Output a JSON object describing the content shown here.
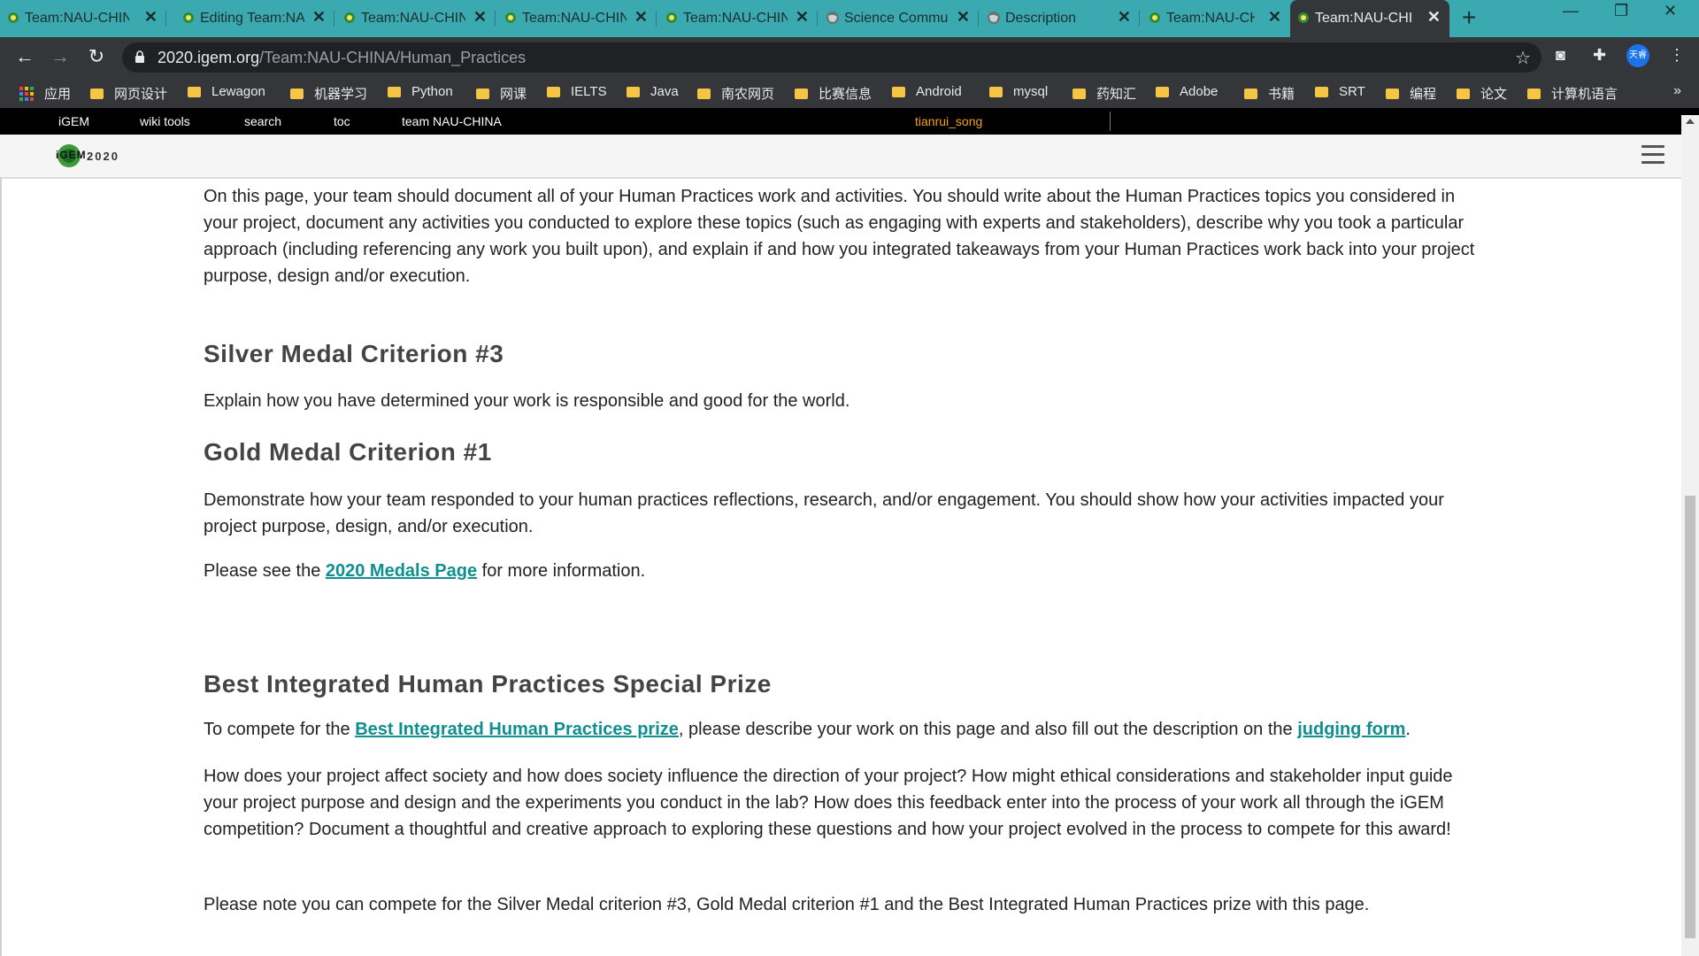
{
  "tabs": [
    {
      "title": "Team:NAU-CHINA",
      "active": false
    },
    {
      "title": "Editing Team:NAU",
      "active": false
    },
    {
      "title": "Team:NAU-CHINA",
      "active": false
    },
    {
      "title": "Team:NAU-CHINA",
      "active": false
    },
    {
      "title": "Team:NAU-CHINA",
      "active": false
    },
    {
      "title": "Science Commun",
      "active": false
    },
    {
      "title": "Description",
      "active": false
    },
    {
      "title": "Team:NAU-CHINA",
      "active": false
    },
    {
      "title": "Team:NAU-CHINA",
      "active": true
    }
  ],
  "window": {
    "new_tab": "+",
    "minimize": "—",
    "restore": "❐",
    "close": "✕"
  },
  "toolbar": {
    "url_domain": "2020.igem.org",
    "url_path": "/Team:NAU-CHINA/Human_Practices",
    "profile_label": "天睿"
  },
  "bookmarks": {
    "apps_label": "应用",
    "items": [
      "网页设计",
      "Lewagon",
      "机器学习",
      "Python",
      "网课",
      "IELTS",
      "Java",
      "南农网页",
      "比赛信息",
      "Android",
      "mysql",
      "药知汇",
      "Adobe",
      "书籍",
      "SRT",
      "编程",
      "论文",
      "计算机语言"
    ],
    "more": "»"
  },
  "igem_bar": {
    "items": [
      "iGEM",
      "wiki tools",
      "search",
      "toc",
      "team NAU-CHINA"
    ],
    "user": "tianrui_song"
  },
  "header": {
    "logo_text": "2020",
    "logo_letters": "iGEM"
  },
  "content": {
    "intro": "On this page, your team should document all of your Human Practices work and activities. You should write about the Human Practices topics you considered in your project, document any activities you conducted to explore these topics (such as engaging with experts and stakeholders), describe why you took a particular approach (including referencing any work you built upon), and explain if and how you integrated takeaways from your Human Practices work back into your project purpose, design and/or execution.",
    "silver_heading": "Silver Medal Criterion #3",
    "silver_text": "Explain how you have determined your work is responsible and good for the world.",
    "gold_heading": "Gold Medal Criterion #1",
    "gold_text": "Demonstrate how your team responded to your human practices reflections, research, and/or engagement. You should show how your activities impacted your project purpose, design, and/or execution.",
    "see_pre": "Please see the ",
    "see_link": "2020 Medals Page",
    "see_post": " for more information.",
    "best_heading": "Best Integrated Human Practices Special Prize",
    "compete_pre": "To compete for the ",
    "compete_link1": "Best Integrated Human Practices prize",
    "compete_mid": ", please describe your work on this page and also fill out the description on the ",
    "compete_link2": "judging form",
    "compete_post": ".",
    "questions": "How does your project affect society and how does society influence the direction of your project? How might ethical considerations and stakeholder input guide your project purpose and design and the experiments you conduct in the lab? How does this feedback enter into the process of your work all through the iGEM competition? Document a thoughtful and creative approach to exploring these questions and how your project evolved in the process to compete for this award!",
    "note": "Please note you can compete for the Silver Medal criterion #3, Gold Medal criterion #1 and the Best Integrated Human Practices prize with this page."
  }
}
